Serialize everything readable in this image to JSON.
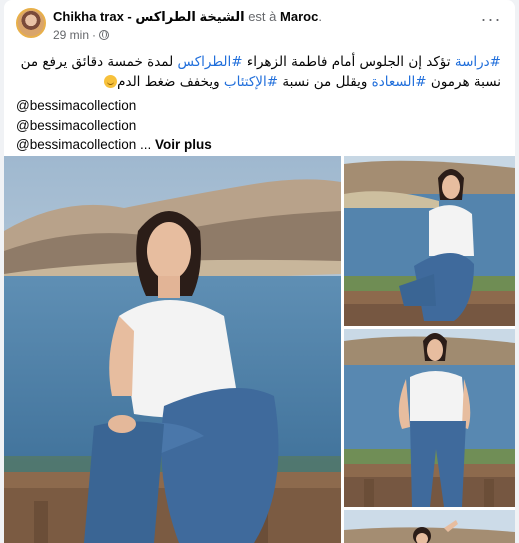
{
  "post": {
    "author": "Chikha trax - الشيخة الطراكس",
    "location_prefix": "est à",
    "location": "Maroc",
    "location_suffix": ".",
    "time": "29 min",
    "time_sep": "·",
    "more_label": "···"
  },
  "text": {
    "line1_tag": "#دراسة",
    "line1_mid": " تؤكد إن الجلوس أمام فاطمة الزهراء ",
    "line1_tag2": "#الطراكس",
    "line1_end": " لمدة خمسة دقائق يرفع من",
    "line2_start": "نسبة هرمون ",
    "line2_tag": "#السعادة",
    "line2_mid": " ويقلل من نسبة ",
    "line2_tag2": "#الإكتئاب",
    "line2_end": " ويخفف ضغط الدم",
    "mention1": "@bessimacollection",
    "mention2": "@bessimacollection",
    "mention3": "@bessimacollection ...",
    "see_more": "Voir plus"
  },
  "colors": {
    "hashtag": "#216fdb",
    "sky": "#bcd3e6",
    "water": "#4d7fa8",
    "hills": "#8a7a68",
    "jeans": "#3f6a9c",
    "shirt": "#f2f2f2"
  },
  "icons": {
    "privacy": "globe-icon",
    "emoji": "smiling-face-icon",
    "menu": "more-horizontal-icon"
  }
}
